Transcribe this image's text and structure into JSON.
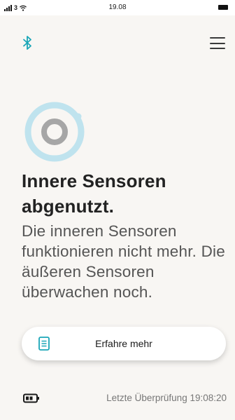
{
  "status_bar": {
    "carrier": "3",
    "time": "19.08"
  },
  "header": {
    "bluetooth_icon": "bluetooth-icon",
    "menu_icon": "hamburger-menu-icon"
  },
  "sensor": {
    "icon": "sensor-ring-icon",
    "ring_color": "#bfe3ee",
    "inner_color": "#a6a6a6"
  },
  "main": {
    "title": "Innere Sensoren abgenutzt.",
    "description": "Die inneren Sensoren funktionieren nicht mehr. Die äußeren Sensoren überwachen noch."
  },
  "learn_more_button": {
    "label": "Erfahre mehr",
    "icon": "document-icon"
  },
  "footer": {
    "battery_icon": "battery-icon",
    "last_check": "Letzte Überprüfung 19:08:20"
  },
  "colors": {
    "accent": "#1aa6b7",
    "background": "#f8f6f3",
    "title": "#222222",
    "body_text": "#555555"
  }
}
